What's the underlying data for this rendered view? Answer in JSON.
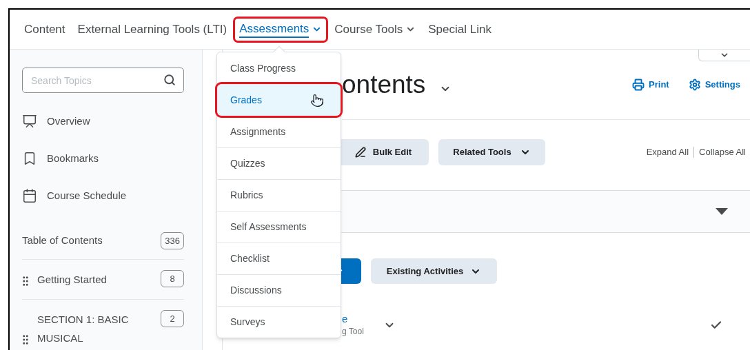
{
  "nav": [
    {
      "label": "Content",
      "dropdown": false,
      "selected": false,
      "highlighted": false
    },
    {
      "label": "External Learning Tools (LTI)",
      "dropdown": false,
      "selected": false,
      "highlighted": false
    },
    {
      "label": "Assessments",
      "dropdown": true,
      "selected": true,
      "highlighted": true
    },
    {
      "label": "Course Tools",
      "dropdown": true,
      "selected": false,
      "highlighted": false
    },
    {
      "label": "Special Link",
      "dropdown": false,
      "selected": false,
      "highlighted": false
    }
  ],
  "sidebar": {
    "search": {
      "placeholder": "Search Topics"
    },
    "items": [
      {
        "kind": "overview",
        "label": "Overview"
      },
      {
        "kind": "bookmarks",
        "label": "Bookmarks"
      },
      {
        "kind": "schedule",
        "label": "Course Schedule"
      }
    ],
    "toc": {
      "label": "Table of Contents",
      "count": "336"
    },
    "modules": [
      {
        "label": "Getting Started",
        "count": "8"
      },
      {
        "label": "SECTION 1: BASIC MUSICAL",
        "count": "2"
      }
    ]
  },
  "menu": {
    "items": [
      {
        "label": "Class Progress",
        "selected": false,
        "highlighted": false
      },
      {
        "label": "Grades",
        "selected": true,
        "highlighted": true
      },
      {
        "label": "Assignments",
        "selected": false,
        "highlighted": false
      },
      {
        "label": "Quizzes",
        "selected": false,
        "highlighted": false
      },
      {
        "label": "Rubrics",
        "selected": false,
        "highlighted": false
      },
      {
        "label": "Self Assessments",
        "selected": false,
        "highlighted": false
      },
      {
        "label": "Checklist",
        "selected": false,
        "highlighted": false
      },
      {
        "label": "Discussions",
        "selected": false,
        "highlighted": false
      },
      {
        "label": "Surveys",
        "selected": false,
        "highlighted": false
      }
    ]
  },
  "main": {
    "title": "ontents",
    "actions": [
      "Print",
      "Settings"
    ],
    "toolbar": [
      "Bulk Edit",
      "Related Tools"
    ],
    "expand": "Expand All",
    "collapse": "Collapse All",
    "add_button": "Existing Activities",
    "item": {
      "title": "e",
      "subtitle": "g Tool",
      "completed": true
    }
  }
}
